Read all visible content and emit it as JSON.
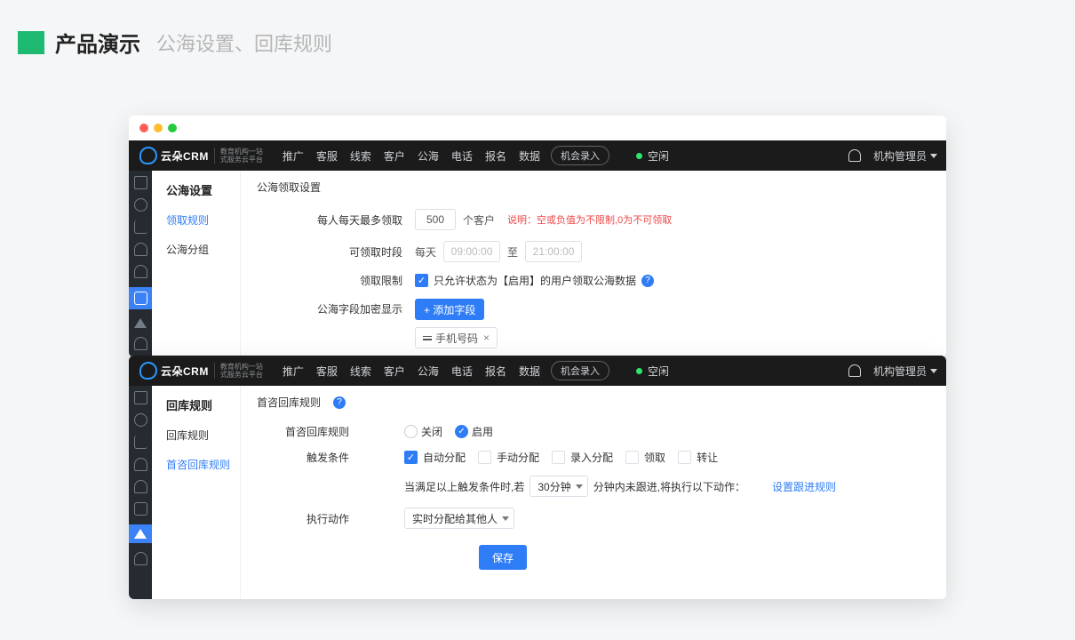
{
  "header": {
    "title": "产品演示",
    "subtitle": "公海设置、回库规则"
  },
  "brand": {
    "name": "云朵CRM",
    "slogan_l1": "教育机构一站",
    "slogan_l2": "式服务云平台"
  },
  "topnav": {
    "items": [
      "推广",
      "客服",
      "线索",
      "客户",
      "公海",
      "电话",
      "报名",
      "数据"
    ],
    "cta": "机会录入",
    "status": "空闲",
    "user": "机构管理员"
  },
  "card1": {
    "side_title": "公海设置",
    "side_items": [
      "领取规则",
      "公海分组"
    ],
    "section_title": "公海领取设置",
    "row1": {
      "label": "每人每天最多领取",
      "value": "500",
      "unit": "个客户",
      "note_prefix": "说明：",
      "note": "空或负值为不限制,0为不可领取"
    },
    "row2": {
      "label": "可领取时段",
      "daily": "每天",
      "from": "09:00:00",
      "to_label": "至",
      "to": "21:00:00"
    },
    "row3": {
      "label": "领取限制",
      "text": "只允许状态为【启用】的用户领取公海数据"
    },
    "row4": {
      "label": "公海字段加密显示",
      "btn": "+ 添加字段",
      "tag": "手机号码"
    }
  },
  "card2": {
    "side_title": "回库规则",
    "side_items": [
      "回库规则",
      "首咨回库规则"
    ],
    "section_title": "首咨回库规则",
    "row1": {
      "label": "首咨回库规则",
      "off": "关闭",
      "on": "启用"
    },
    "row2": {
      "label": "触发条件",
      "opts": [
        "自动分配",
        "手动分配",
        "录入分配",
        "领取",
        "转让"
      ]
    },
    "row3": {
      "pre": "当满足以上触发条件时,若",
      "mid_sel": "30分钟",
      "mid": "分钟内未跟进,将执行以下动作：",
      "link": "设置跟进规则"
    },
    "row4": {
      "label": "执行动作",
      "sel": "实时分配给其他人"
    },
    "save": "保存"
  }
}
